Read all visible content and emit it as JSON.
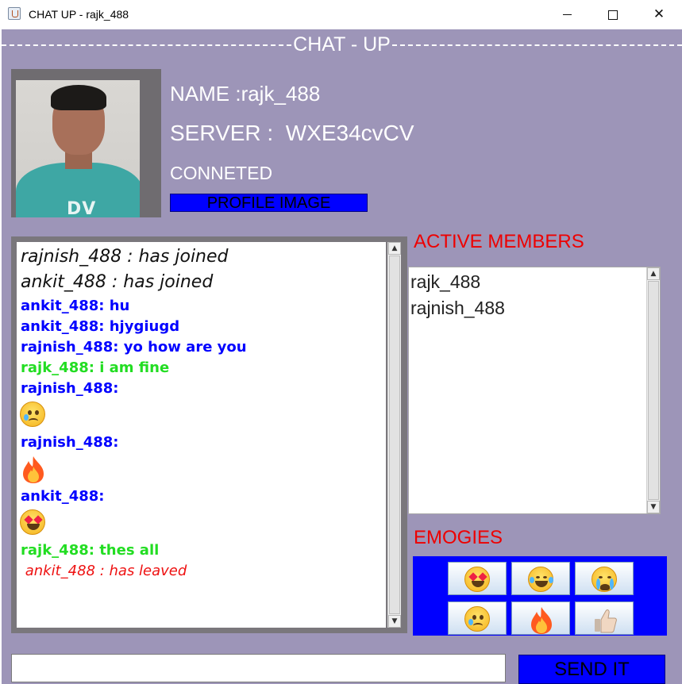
{
  "window": {
    "title": "CHAT UP - rajk_488"
  },
  "header": {
    "title": "CHAT - UP"
  },
  "profile": {
    "name_text": "NAME :rajk_488",
    "server_text": "SERVER :  WXE34cvCV",
    "status_text": "CONNETED",
    "profile_button": "PROFILE IMAGE",
    "shirt_text": "DV"
  },
  "chat": {
    "messages": [
      {
        "text": "rajnish_488 : has joined",
        "kind": "system"
      },
      {
        "text": "ankit_488 : has joined",
        "kind": "system"
      },
      {
        "text": "ankit_488: hu",
        "kind": "blue"
      },
      {
        "text": "ankit_488: hjygiugd",
        "kind": "blue"
      },
      {
        "text": "rajnish_488: yo how are you",
        "kind": "blue"
      },
      {
        "text": "rajk_488: i am fine",
        "kind": "green"
      },
      {
        "text": "rajnish_488:",
        "kind": "blue",
        "emoji": "crying-face-icon"
      },
      {
        "text": "rajnish_488:",
        "kind": "blue",
        "emoji": "fire-icon"
      },
      {
        "text": "ankit_488:",
        "kind": "blue",
        "emoji": "heart-eyes-icon"
      },
      {
        "text": "rajk_488: thes all",
        "kind": "green"
      },
      {
        "text": " ankit_488 : has leaved",
        "kind": "leave"
      }
    ]
  },
  "members": {
    "label": "ACTIVE MEMBERS",
    "items": [
      "rajk_488",
      "rajnish_488"
    ]
  },
  "emojis": {
    "label": "EMOGIES",
    "buttons": [
      "heart-eyes-icon",
      "tears-of-joy-icon",
      "loudly-crying-icon",
      "crying-face-icon",
      "fire-icon",
      "thumbs-up-icon"
    ]
  },
  "input": {
    "value": ""
  },
  "send_button": "SEND IT",
  "colors": {
    "frame": "#9d95b8",
    "accent_blue": "#0000ff",
    "label_red": "#ee0000",
    "own_green": "#22dd22"
  }
}
